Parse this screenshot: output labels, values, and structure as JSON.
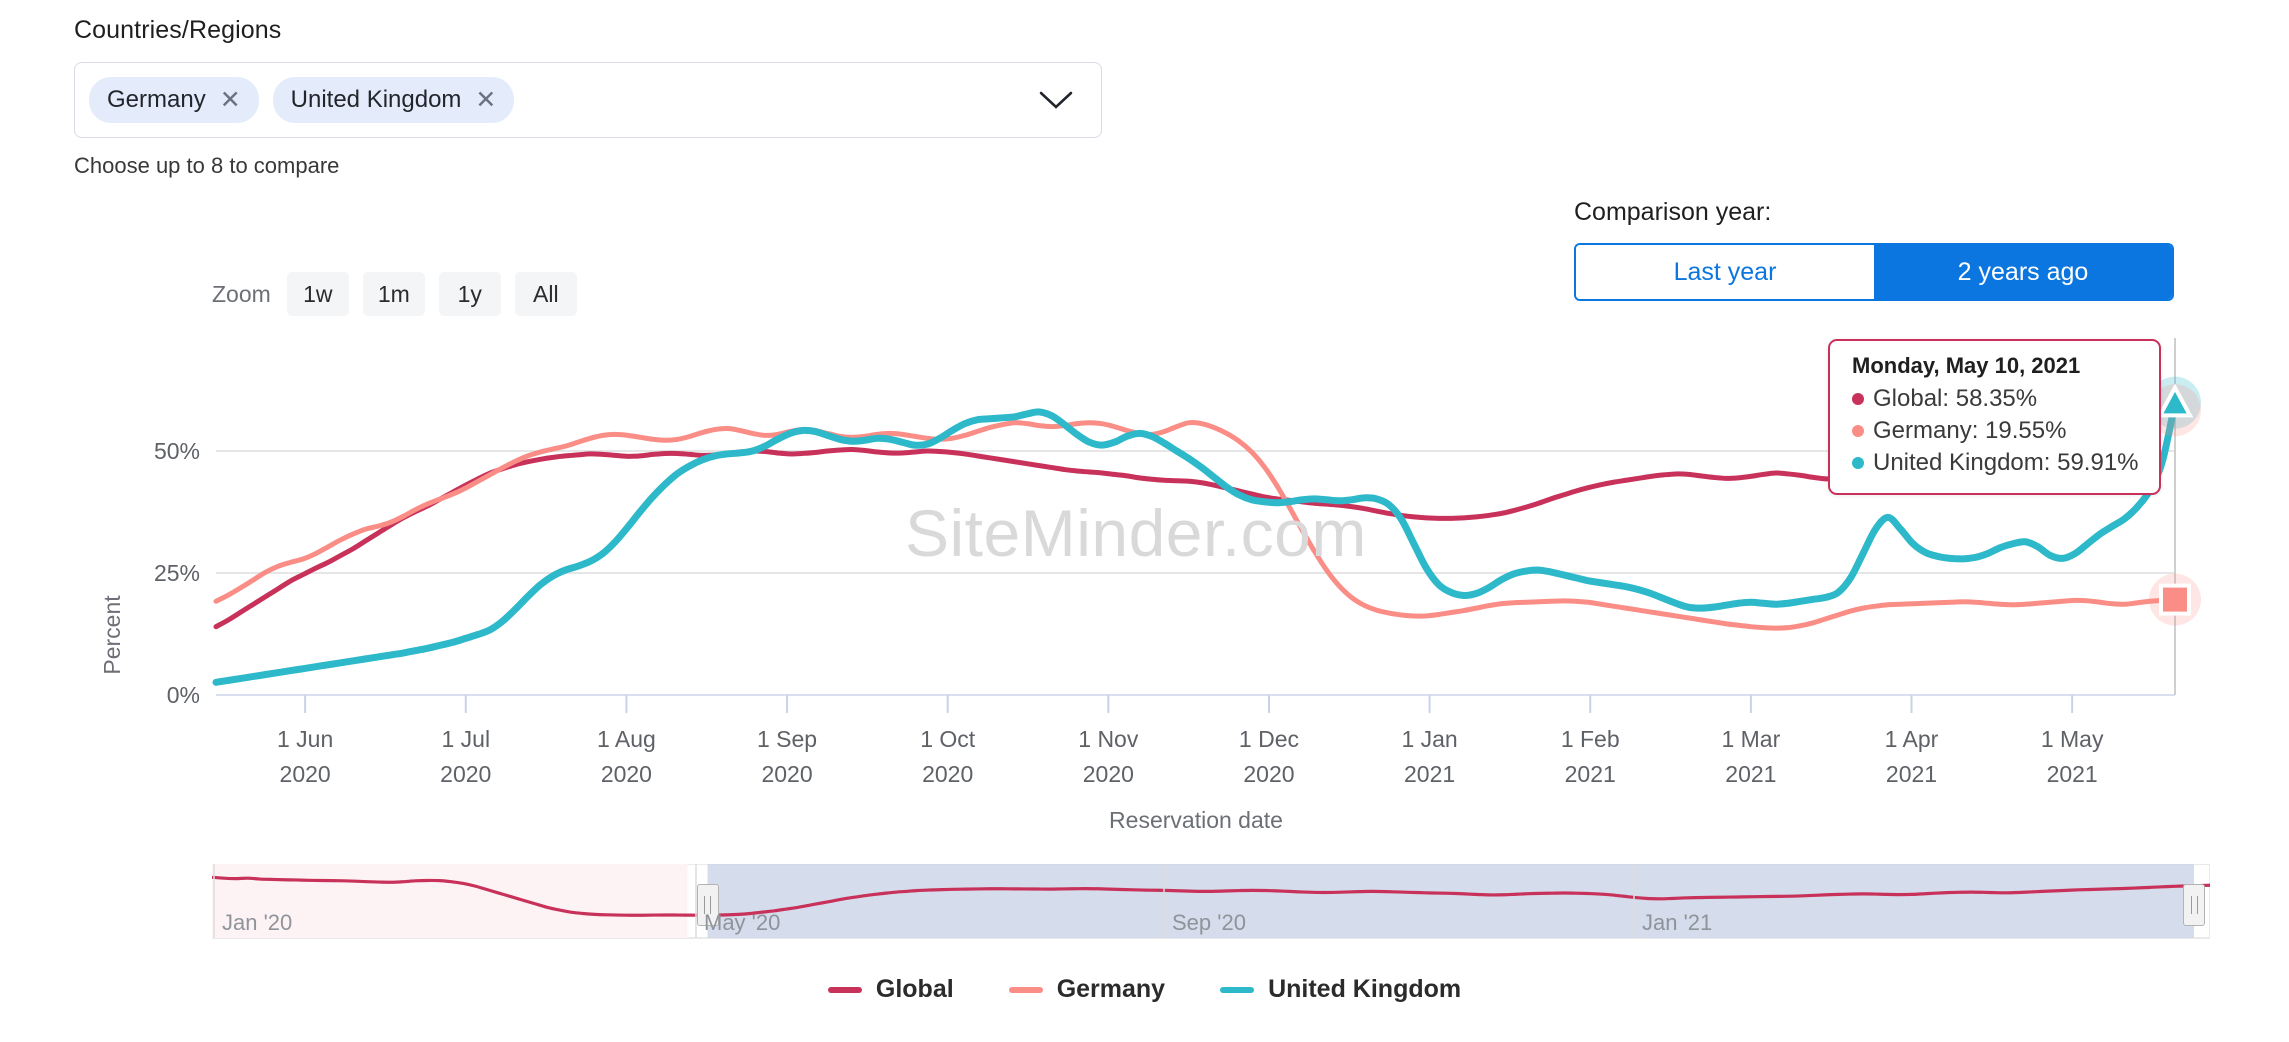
{
  "selector": {
    "label": "Countries/Regions",
    "chips": [
      {
        "name": "Germany",
        "remove": "✕"
      },
      {
        "name": "United Kingdom",
        "remove": "✕"
      }
    ],
    "help_text": "Choose up to 8 to compare",
    "caret_icon": "chevron-down-icon"
  },
  "comparison": {
    "label": "Comparison year:",
    "options": [
      {
        "label": "Last year",
        "active": false
      },
      {
        "label": "2 years ago",
        "active": true
      }
    ]
  },
  "zoom": {
    "label": "Zoom",
    "buttons": [
      "1w",
      "1m",
      "1y",
      "All"
    ]
  },
  "tooltip": {
    "date": "Monday, May 10, 2021",
    "rows": [
      {
        "name": "Global",
        "value": "58.35%",
        "color": "#c8325a"
      },
      {
        "name": "Germany",
        "value": "19.55%",
        "color": "#fa8d86"
      },
      {
        "name": "United Kingdom",
        "value": "59.91%",
        "color": "#2db9ca"
      }
    ]
  },
  "watermark": "SiteMinder.com",
  "navigator": {
    "ticks": [
      "Jan '20",
      "May '20",
      "Sep '20",
      "Jan '21"
    ],
    "tick_x": [
      10,
      492,
      960,
      1430
    ],
    "selection_start_pct": 24.8,
    "selection_end_pct": 99.2
  },
  "legend": [
    {
      "label": "Global",
      "color": "#c8325a"
    },
    {
      "label": "Germany",
      "color": "#fa8d86"
    },
    {
      "label": "United Kingdom",
      "color": "#2db9ca"
    }
  ],
  "chart_data": {
    "type": "line",
    "title": "",
    "xlabel": "Reservation date",
    "ylabel": "Percent",
    "ylim": [
      0,
      62.5
    ],
    "yticks": [
      0,
      25,
      50
    ],
    "ytick_labels": [
      "0%",
      "25%",
      "50%"
    ],
    "grid": true,
    "legend_position": "bottom",
    "xtick_labels": [
      "1 Jun\n2020",
      "1 Jul\n2020",
      "1 Aug\n2020",
      "1 Sep\n2020",
      "1 Oct\n2020",
      "1 Nov\n2020",
      "1 Dec\n2020",
      "1 Jan\n2021",
      "1 Feb\n2021",
      "1 Mar\n2021",
      "1 Apr\n2021",
      "1 May\n2021"
    ],
    "xtick_months": [
      "Jun 2020",
      "Jul 2020",
      "Aug 2020",
      "Sep 2020",
      "Oct 2020",
      "Nov 2020",
      "Dec 2020",
      "Jan 2021",
      "Feb 2021",
      "Mar 2021",
      "Apr 2021",
      "May 2021"
    ],
    "x_start": "2020-05-15",
    "x_end": "2021-05-12",
    "series": [
      {
        "name": "Global",
        "color": "#c8325a",
        "end_value": 58.35,
        "values": [
          14.0,
          15.4,
          17.0,
          18.6,
          20.2,
          21.8,
          23.4,
          24.7,
          26.0,
          27.2,
          28.6,
          30.0,
          31.6,
          33.2,
          34.8,
          36.3,
          37.6,
          38.8,
          40.2,
          41.6,
          43.0,
          44.3,
          45.5,
          46.4,
          47.2,
          47.8,
          48.3,
          48.7,
          49.0,
          49.2,
          49.4,
          49.3,
          49.1,
          48.9,
          49.0,
          49.3,
          49.5,
          49.5,
          49.3,
          49.1,
          49.2,
          49.5,
          49.8,
          50.0,
          49.9,
          49.6,
          49.4,
          49.5,
          49.7,
          50.0,
          50.2,
          50.3,
          50.1,
          49.8,
          49.6,
          49.6,
          49.8,
          50.0,
          49.9,
          49.7,
          49.4,
          49.0,
          48.6,
          48.2,
          47.8,
          47.4,
          47.0,
          46.6,
          46.2,
          45.9,
          45.7,
          45.5,
          45.2,
          44.9,
          44.5,
          44.2,
          44.0,
          43.9,
          43.8,
          43.5,
          43.0,
          42.4,
          41.8,
          41.2,
          40.6,
          40.2,
          39.9,
          39.6,
          39.3,
          39.1,
          38.9,
          38.6,
          38.2,
          37.7,
          37.2,
          36.8,
          36.5,
          36.3,
          36.2,
          36.2,
          36.3,
          36.5,
          36.8,
          37.2,
          37.8,
          38.5,
          39.3,
          40.2,
          41.0,
          41.8,
          42.5,
          43.1,
          43.6,
          44.0,
          44.4,
          44.8,
          45.1,
          45.3,
          45.2,
          44.9,
          44.6,
          44.4,
          44.5,
          44.8,
          45.2,
          45.5,
          45.3,
          45.0,
          44.6,
          44.3,
          44.4,
          44.8,
          45.4,
          46.2,
          47.0,
          47.6,
          48.0,
          48.1,
          48.0,
          47.8,
          47.9,
          48.4,
          49.2,
          50.2,
          51.2,
          52.0,
          52.7,
          53.3,
          53.8,
          54.3,
          54.9,
          55.5,
          56.2,
          56.9,
          57.5,
          58.0,
          58.2,
          58.35
        ]
      },
      {
        "name": "Germany",
        "color": "#fa8d86",
        "end_value": 19.55,
        "values": [
          19.2,
          20.5,
          22.0,
          23.6,
          25.2,
          26.4,
          27.2,
          27.9,
          29.0,
          30.4,
          31.8,
          33.0,
          34.0,
          34.6,
          35.4,
          36.6,
          38.0,
          39.2,
          40.2,
          41.2,
          42.4,
          43.8,
          45.2,
          46.6,
          47.9,
          49.0,
          49.8,
          50.4,
          51.0,
          51.8,
          52.6,
          53.2,
          53.4,
          53.2,
          52.8,
          52.4,
          52.2,
          52.4,
          53.0,
          53.8,
          54.4,
          54.6,
          54.2,
          53.6,
          53.2,
          53.4,
          54.0,
          54.4,
          54.2,
          53.6,
          53.0,
          52.8,
          53.0,
          53.4,
          53.6,
          53.4,
          53.0,
          52.6,
          52.4,
          52.6,
          53.2,
          54.0,
          54.8,
          55.4,
          55.8,
          55.6,
          55.2,
          55.0,
          55.2,
          55.6,
          55.8,
          55.6,
          55.0,
          54.2,
          53.6,
          53.4,
          54.0,
          55.0,
          55.8,
          55.6,
          54.8,
          53.6,
          52.0,
          49.8,
          46.8,
          43.0,
          38.6,
          34.0,
          29.6,
          25.6,
          22.4,
          20.0,
          18.4,
          17.4,
          16.8,
          16.4,
          16.2,
          16.2,
          16.5,
          16.9,
          17.3,
          17.8,
          18.3,
          18.7,
          18.9,
          19.0,
          19.1,
          19.2,
          19.3,
          19.2,
          19.0,
          18.6,
          18.2,
          17.8,
          17.4,
          17.0,
          16.6,
          16.2,
          15.8,
          15.4,
          15.0,
          14.6,
          14.3,
          14.0,
          13.8,
          13.7,
          13.8,
          14.2,
          14.8,
          15.6,
          16.4,
          17.2,
          17.8,
          18.2,
          18.5,
          18.6,
          18.7,
          18.8,
          18.9,
          19.0,
          19.1,
          19.0,
          18.8,
          18.6,
          18.5,
          18.6,
          18.8,
          19.0,
          19.2,
          19.4,
          19.3,
          19.0,
          18.7,
          18.6,
          18.9,
          19.2,
          19.4,
          19.55
        ]
      },
      {
        "name": "United Kingdom",
        "color": "#2db9ca",
        "end_value": 59.91,
        "values": [
          2.6,
          3.0,
          3.4,
          3.8,
          4.2,
          4.6,
          5.0,
          5.4,
          5.8,
          6.2,
          6.6,
          7.0,
          7.4,
          7.8,
          8.2,
          8.6,
          9.1,
          9.6,
          10.2,
          10.8,
          11.6,
          12.4,
          13.4,
          15.2,
          17.6,
          20.2,
          22.6,
          24.4,
          25.6,
          26.4,
          27.4,
          29.0,
          31.4,
          34.4,
          37.6,
          40.6,
          43.2,
          45.4,
          47.0,
          48.2,
          49.0,
          49.4,
          49.6,
          50.0,
          51.0,
          52.4,
          53.6,
          54.2,
          54.0,
          53.2,
          52.4,
          52.0,
          52.2,
          52.6,
          52.4,
          51.8,
          51.2,
          51.4,
          52.6,
          54.2,
          55.6,
          56.4,
          56.6,
          56.8,
          57.0,
          57.6,
          58.0,
          57.2,
          55.4,
          53.4,
          51.8,
          51.2,
          51.8,
          53.0,
          53.6,
          53.0,
          51.6,
          50.0,
          48.4,
          46.6,
          44.6,
          42.6,
          41.0,
          40.0,
          39.6,
          39.4,
          39.6,
          40.0,
          40.2,
          40.0,
          39.8,
          40.0,
          40.4,
          40.2,
          39.0,
          36.0,
          31.0,
          26.0,
          22.6,
          21.0,
          20.4,
          20.8,
          22.0,
          23.6,
          24.8,
          25.4,
          25.6,
          25.2,
          24.6,
          24.0,
          23.4,
          23.0,
          22.6,
          22.2,
          21.6,
          20.8,
          19.8,
          18.8,
          18.0,
          17.8,
          18.0,
          18.4,
          18.8,
          19.0,
          18.8,
          18.6,
          18.8,
          19.2,
          19.6,
          20.0,
          21.0,
          24.0,
          29.0,
          34.0,
          36.4,
          34.0,
          31.0,
          29.2,
          28.4,
          28.0,
          27.9,
          28.2,
          29.0,
          30.2,
          31.0,
          31.4,
          30.4,
          28.6,
          28.0,
          29.0,
          31.0,
          33.0,
          34.6,
          36.2,
          38.6,
          42.0,
          48.0,
          59.91
        ]
      }
    ]
  }
}
